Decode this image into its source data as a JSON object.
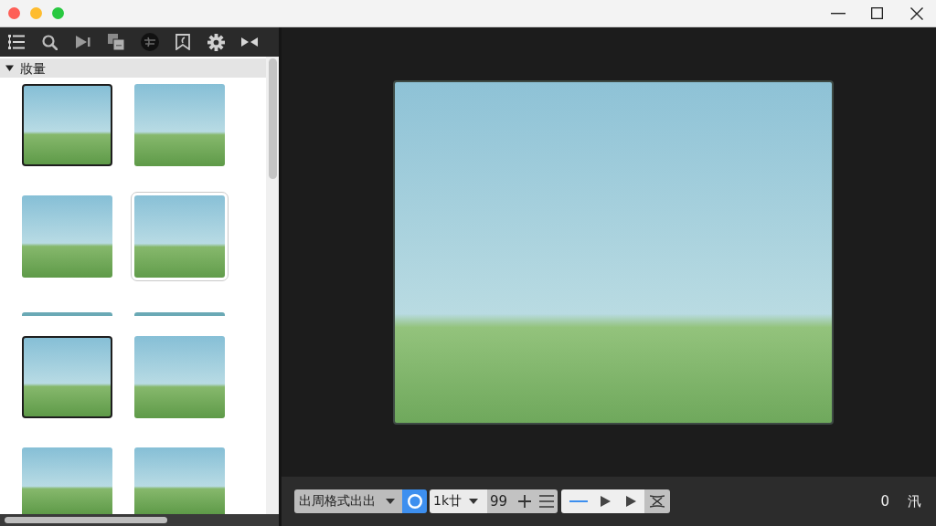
{
  "sidebar": {
    "group": {
      "label": "妝量",
      "expanded": true
    },
    "thumbnails": [
      {
        "kind": "full",
        "selected": true,
        "highlighted": false
      },
      {
        "kind": "full",
        "selected": false,
        "highlighted": false
      },
      {
        "kind": "full",
        "selected": false,
        "highlighted": false
      },
      {
        "kind": "full",
        "selected": false,
        "highlighted": true
      },
      {
        "kind": "strip",
        "selected": false,
        "highlighted": false
      },
      {
        "kind": "strip",
        "selected": false,
        "highlighted": false
      },
      {
        "kind": "full",
        "selected": true,
        "highlighted": false
      },
      {
        "kind": "full",
        "selected": false,
        "highlighted": false
      },
      {
        "kind": "partial",
        "selected": false,
        "highlighted": false
      },
      {
        "kind": "partial",
        "selected": false,
        "highlighted": false
      }
    ]
  },
  "bottom_bar": {
    "format_dropdown": {
      "value": "出周格式出出"
    },
    "circle_toggle": {
      "on": true
    },
    "size_dropdown": {
      "value": "1k廿"
    },
    "count": "99",
    "counter": "0",
    "status": "汛"
  }
}
